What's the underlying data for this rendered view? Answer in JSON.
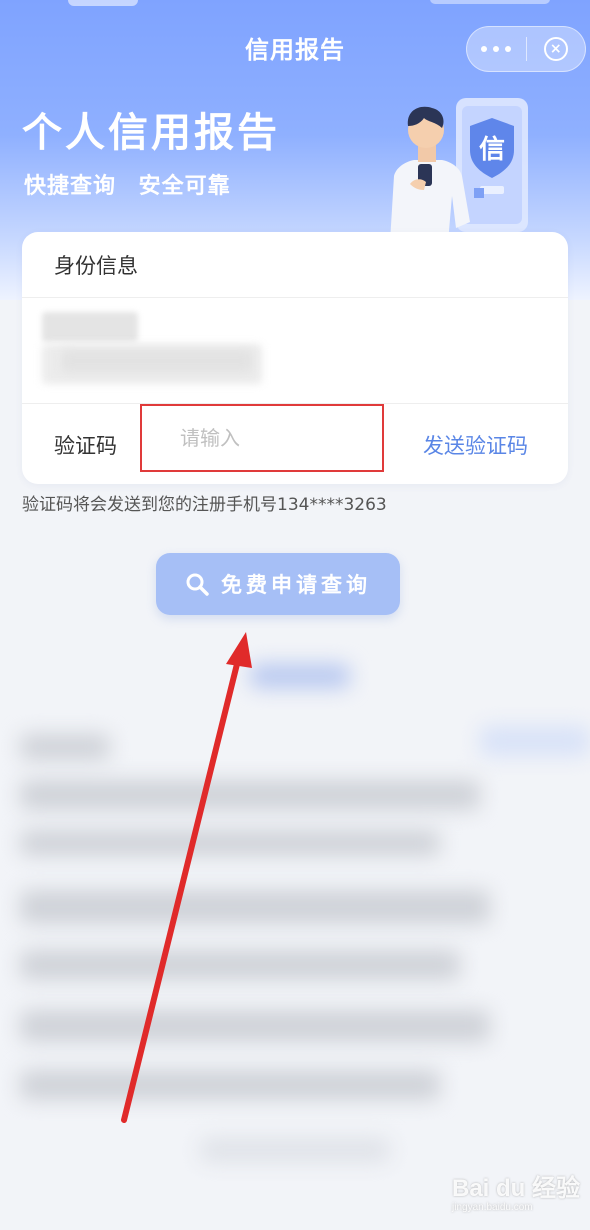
{
  "nav": {
    "title": "信用报告",
    "more_icon": "more-dots-icon",
    "close_icon": "close-circle-icon"
  },
  "hero": {
    "title": "个人信用报告",
    "subtitle": "快捷查询 安全可靠",
    "badge_char": "信"
  },
  "card": {
    "section_title": "身份信息",
    "verify_label": "验证码",
    "verify_placeholder": "请输入",
    "verify_value": "",
    "send_code_label": "发送验证码"
  },
  "hint": "验证码将会发送到您的注册手机号134****3263",
  "query_button": {
    "label": "免费申请查询",
    "icon": "search-icon"
  },
  "watermark": {
    "text": "Bai du 经验",
    "sub": "jingyan.baidu.com"
  },
  "colors": {
    "hero_blue": "#7fa3ff",
    "link_blue": "#5a86e6",
    "button_blue": "#a6bff6",
    "highlight_red": "#e03a3a"
  }
}
